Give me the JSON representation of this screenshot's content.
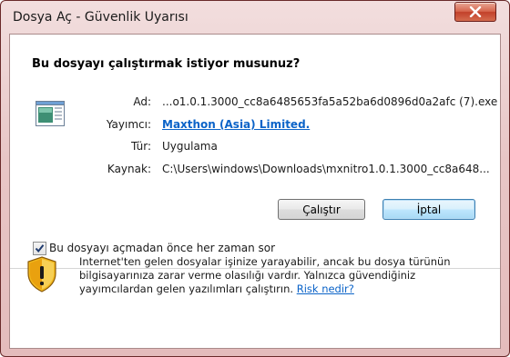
{
  "window": {
    "title": "Dosya Aç - Güvenlik Uyarısı"
  },
  "dialog": {
    "question": "Bu dosyayı çalıştırmak istiyor musunuz?",
    "details": {
      "name_label": "Ad:",
      "name_value": "...o1.0.1.3000_cc8a6485653fa5a52ba6d0896d0a2afc (7).exe",
      "publisher_label": "Yayımcı:",
      "publisher_value": "Maxthon (Asia) Limited.",
      "type_label": "Tür:",
      "type_value": "Uygulama",
      "source_label": "Kaynak:",
      "source_value": "C:\\Users\\windows\\Downloads\\mxnitro1.0.1.3000_cc8a648..."
    },
    "buttons": {
      "run": "Çalıştır",
      "cancel": "İptal"
    },
    "checkbox": {
      "label": "Bu dosyayı açmadan önce her zaman sor",
      "checked": true
    },
    "warning": {
      "text": "Internet'ten gelen dosyalar işinize yarayabilir, ancak bu dosya türünün bilgisayarınıza zarar verme olasılığı vardır. Yalnızca güvendiğiniz yayımcılardan gelen yazılımları çalıştırın.",
      "link": "Risk nedir?"
    }
  },
  "icons": {
    "close": "close-icon",
    "file": "executable-file-icon",
    "shield": "security-warning-shield-icon",
    "check": "checkmark-icon"
  },
  "colors": {
    "titlebar": "#e8c6c6",
    "close_button": "#c2402a",
    "link": "#0b63c8",
    "default_button_border": "#3c7fb1",
    "shield_yellow": "#f2b81c"
  }
}
